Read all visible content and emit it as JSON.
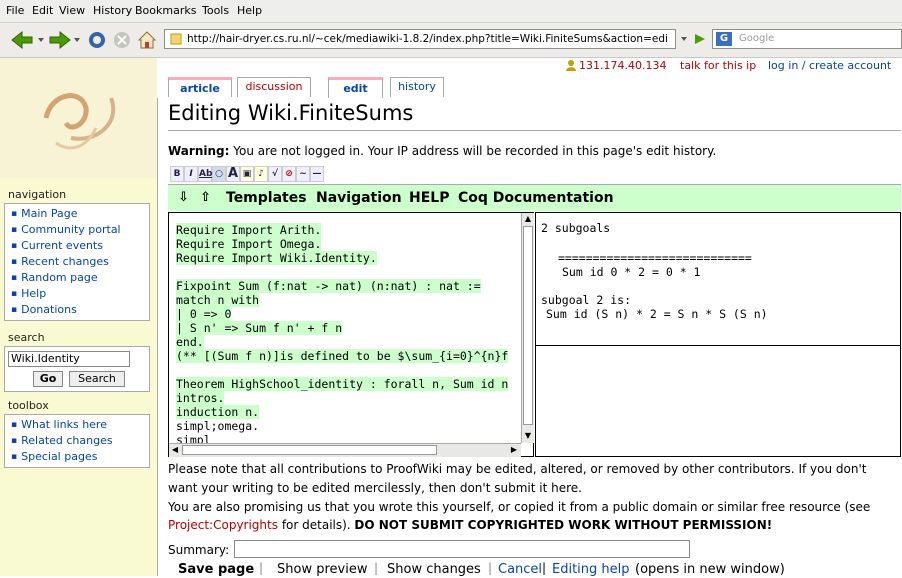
{
  "menu": [
    "File",
    "Edit",
    "View",
    "History",
    "Bookmarks",
    "Tools",
    "Help"
  ],
  "browser": {
    "url": "http://hair-dryer.cs.ru.nl/~cek/mediawiki-1.8.2/index.php?title=Wiki.FiniteSums&action=edi",
    "search_placeholder": "Google"
  },
  "personal": {
    "ip": "131.174.40.134",
    "talk": "talk for this ip",
    "login": "log in / create account"
  },
  "tabs": [
    "article",
    "discussion",
    "edit",
    "history"
  ],
  "page_title": "Editing Wiki.FiniteSums",
  "warning": {
    "bold": "Warning:",
    "text": " You are not logged in. Your IP address will be recorded in this page's edit history."
  },
  "greenbar": [
    "Templates",
    "Navigation",
    "HELP",
    "Coq Documentation"
  ],
  "editor_lines": [
    "Require Import Arith.",
    "Require Import Omega.",
    "Require Import Wiki.Identity.",
    "",
    "Fixpoint Sum (f:nat -> nat) (n:nat) : nat :=",
    "match n with",
    "| 0 => 0",
    "| S n' => Sum f n' + f n",
    "end.",
    "(** [(Sum f n)]is defined to be $\\sum_{i=0}^{n}f",
    "",
    "Theorem HighSchool_identity : forall n, Sum id n",
    "intros.",
    "induction n.",
    "simpl;omega.",
    "simpl"
  ],
  "goals": {
    "count": "2 subgoals",
    "rule": "============================",
    "goal1": "Sum id 0 * 2 = 0 * 1",
    "sub2_label": "subgoal 2 is:",
    "goal2": "Sum id (S n) * 2 = S n * S (S n)"
  },
  "sidebar": {
    "nav_title": "navigation",
    "nav_items": [
      "Main Page",
      "Community portal",
      "Current events",
      "Recent changes",
      "Random page",
      "Help",
      "Donations"
    ],
    "search_title": "search",
    "search_value": "Wiki.Identity",
    "go": "Go",
    "search_btn": "Search",
    "toolbox_title": "toolbox",
    "toolbox_items": [
      "What links here",
      "Related changes",
      "Special pages"
    ]
  },
  "notes": {
    "line1": "Please note that all contributions to ProofWiki may be edited, altered, or removed by other contributors. If you don't",
    "line2": "want your writing to be edited mercilessly, then don't submit it here.",
    "line3": "You are also promising us that you wrote this yourself, or copied it from a public domain or similar free resource (see",
    "link": "Project:Copyrights",
    "line4": " for details). ",
    "bold": "DO NOT SUBMIT COPYRIGHTED WORK WITHOUT PERMISSION!"
  },
  "summary_label": "Summary:",
  "buttons": {
    "save": "Save page",
    "preview": "Show preview",
    "changes": "Show changes",
    "cancel": "Cancel",
    "help": "Editing help",
    "help_note": "(opens in new window)"
  }
}
